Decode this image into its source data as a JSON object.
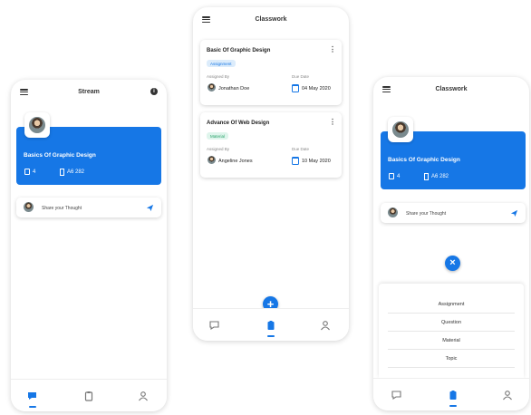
{
  "stream": {
    "title": "Stream",
    "course": {
      "name": "Basics Of Graphic Design",
      "count": "4",
      "room": "A6 282"
    },
    "share_placeholder": "Share your Thought"
  },
  "classwork": {
    "title": "Classwork",
    "labels": {
      "assigned_by": "Assigned By",
      "due_date": "Due Date"
    },
    "cards": [
      {
        "title": "Basic Of Graphic Design",
        "tag": "Assignment",
        "person": "Jonathan Doe",
        "date": "04 May 2020"
      },
      {
        "title": "Advance Of Web Design",
        "tag": "Material",
        "person": "Angeline Jones",
        "date": "10 May 2020"
      }
    ]
  },
  "classwork_menu": {
    "title": "Classwork",
    "course": {
      "name": "Basics Of Graphic Design",
      "count": "4",
      "room": "A6 282"
    },
    "share_placeholder": "Share your Thought",
    "menu_items": [
      "Assignment",
      "Question",
      "Material",
      "Topic"
    ]
  },
  "colors": {
    "accent": "#1677e6",
    "material_tag": "#2aa36b"
  },
  "icons": [
    "menu-icon",
    "info-icon",
    "send-icon",
    "chat-icon",
    "clipboard-icon",
    "person-icon",
    "calendar-icon",
    "close-icon",
    "plus-icon"
  ]
}
